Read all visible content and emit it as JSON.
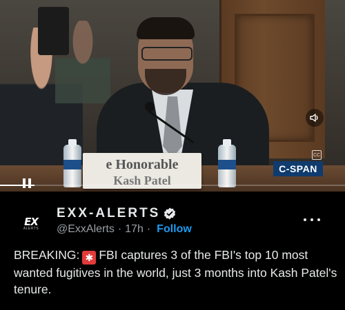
{
  "video": {
    "nameplate_line1": "e Honorable",
    "nameplate_line2": "Kash Patel",
    "network_logo": "C-SPAN",
    "cc_label": "CC",
    "icons": {
      "volume": "volume-icon",
      "pause": "pause-icon",
      "closed_captions": "cc-icon"
    },
    "progress_fraction": 0.1,
    "colors": {
      "network_logo_bg": "#0f3b6e"
    }
  },
  "post": {
    "display_name": "EXX-ALERTS",
    "avatar_text": "EX",
    "avatar_sub": "ALERTS",
    "handle": "@ExxAlerts",
    "separator": "·",
    "time": "17h",
    "follow_label": "Follow",
    "text_before_emoji": "BREAKING:",
    "emoji": "✱",
    "text_after_emoji": "FBI captures 3 of the FBI's top 10 most wanted fugitives in the world, just 3 months into Kash Patel's tenure.",
    "icons": {
      "verified": "verified-badge-icon",
      "more": "more-options-icon",
      "emoji": "siren-emoji-icon"
    },
    "colors": {
      "accent": "#1d9bf0",
      "text": "#e7e9ea",
      "muted": "#9aa0a6"
    }
  }
}
